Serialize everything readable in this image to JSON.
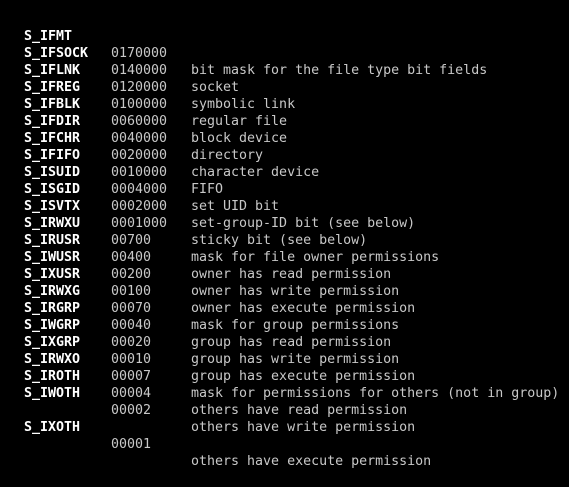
{
  "colors": {
    "background": "#000000",
    "name_text": "#ffffff",
    "body_text": "#c8c8c8"
  },
  "rows": [
    {
      "name": "S_IFMT",
      "value": "0170000",
      "desc": "bit mask for the file type bit fields"
    },
    {
      "name": "S_IFSOCK",
      "value": "0140000",
      "desc": "socket"
    },
    {
      "name": "S_IFLNK",
      "value": "0120000",
      "desc": "symbolic link"
    },
    {
      "name": "S_IFREG",
      "value": "0100000",
      "desc": "regular file"
    },
    {
      "name": "S_IFBLK",
      "value": "0060000",
      "desc": "block device"
    },
    {
      "name": "S_IFDIR",
      "value": "0040000",
      "desc": "directory"
    },
    {
      "name": "S_IFCHR",
      "value": "0020000",
      "desc": "character device"
    },
    {
      "name": "S_IFIFO",
      "value": "0010000",
      "desc": "FIFO"
    },
    {
      "name": "S_ISUID",
      "value": "0004000",
      "desc": "set UID bit"
    },
    {
      "name": "S_ISGID",
      "value": "0002000",
      "desc": "set-group-ID bit (see below)"
    },
    {
      "name": "S_ISVTX",
      "value": "0001000",
      "desc": "sticky bit (see below)"
    },
    {
      "name": "S_IRWXU",
      "value": "00700",
      "desc": "mask for file owner permissions"
    },
    {
      "name": "S_IRUSR",
      "value": "00400",
      "desc": "owner has read permission"
    },
    {
      "name": "S_IWUSR",
      "value": "00200",
      "desc": "owner has write permission"
    },
    {
      "name": "S_IXUSR",
      "value": "00100",
      "desc": "owner has execute permission"
    },
    {
      "name": "S_IRWXG",
      "value": "00070",
      "desc": "mask for group permissions"
    },
    {
      "name": "S_IRGRP",
      "value": "00040",
      "desc": "group has read permission"
    },
    {
      "name": "S_IWGRP",
      "value": "00020",
      "desc": "group has write permission"
    },
    {
      "name": "S_IXGRP",
      "value": "00010",
      "desc": "group has execute permission"
    },
    {
      "name": "S_IRWXO",
      "value": "00007",
      "desc": "mask for permissions for others (not in group)"
    },
    {
      "name": "S_IROTH",
      "value": "00004",
      "desc": "others have read permission"
    },
    {
      "name": "S_IWOTH",
      "value": "00002",
      "desc": "others have write permission"
    },
    {
      "name": "S_IXOTH",
      "value": "00001",
      "desc": "others have execute permission"
    }
  ]
}
